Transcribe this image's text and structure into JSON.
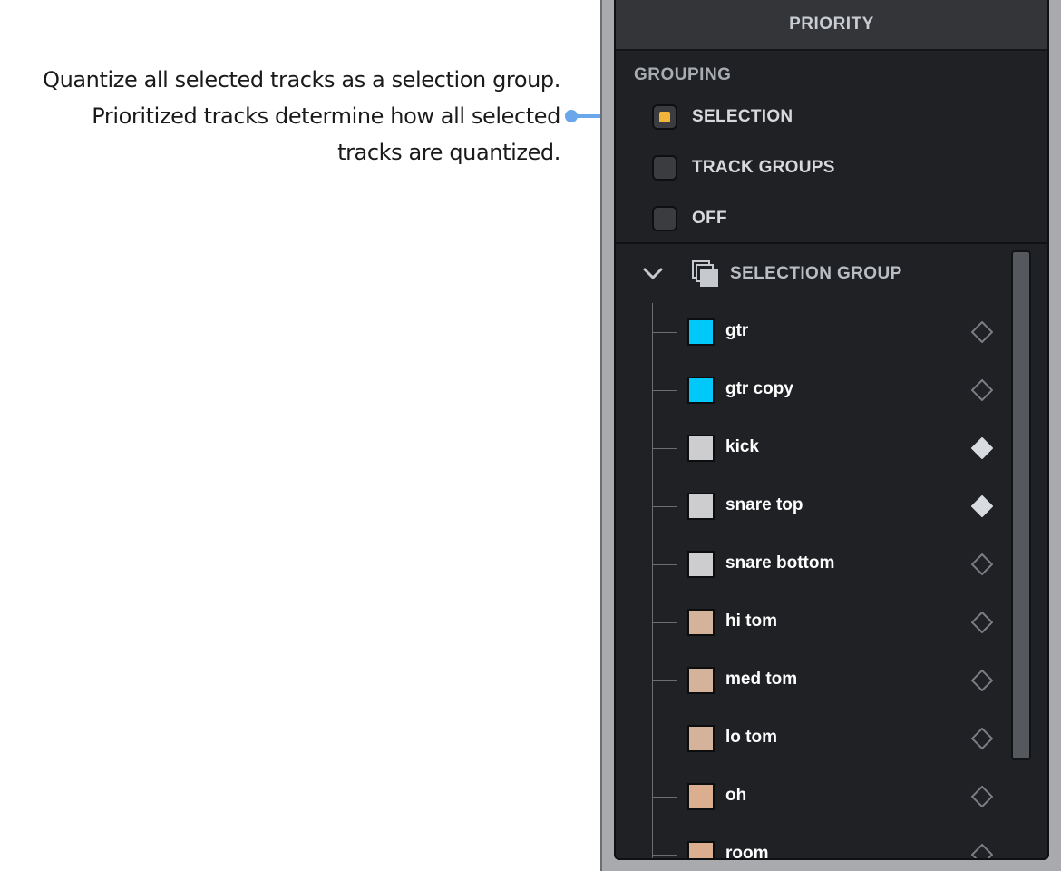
{
  "callout": {
    "lines": [
      "Quantize  all selected tracks as a selection group.",
      "Prioritized tracks determine how all selected",
      "tracks are quantized."
    ],
    "accent": "#6aa6ea"
  },
  "panel": {
    "header": "PRIORITY",
    "grouping_label": "GROUPING",
    "options": [
      {
        "label": "SELECTION",
        "checked": true
      },
      {
        "label": "TRACK GROUPS",
        "checked": false
      },
      {
        "label": "OFF",
        "checked": false
      }
    ],
    "group": {
      "label": "SELECTION GROUP",
      "expanded": true,
      "tracks": [
        {
          "name": "gtr",
          "color": "#00c8f8",
          "prioritized": false
        },
        {
          "name": "gtr copy",
          "color": "#00c8f8",
          "prioritized": false
        },
        {
          "name": "kick",
          "color": "#cdcdcf",
          "prioritized": true
        },
        {
          "name": "snare top",
          "color": "#cdcdcf",
          "prioritized": true
        },
        {
          "name": "snare bottom",
          "color": "#cdcdcf",
          "prioritized": false
        },
        {
          "name": "hi tom",
          "color": "#d5b29a",
          "prioritized": false
        },
        {
          "name": "med tom",
          "color": "#d5b29a",
          "prioritized": false
        },
        {
          "name": "lo tom",
          "color": "#d5b29a",
          "prioritized": false
        },
        {
          "name": "oh",
          "color": "#dcae90",
          "prioritized": false
        },
        {
          "name": "room",
          "color": "#dcae90",
          "prioritized": false
        }
      ]
    }
  }
}
